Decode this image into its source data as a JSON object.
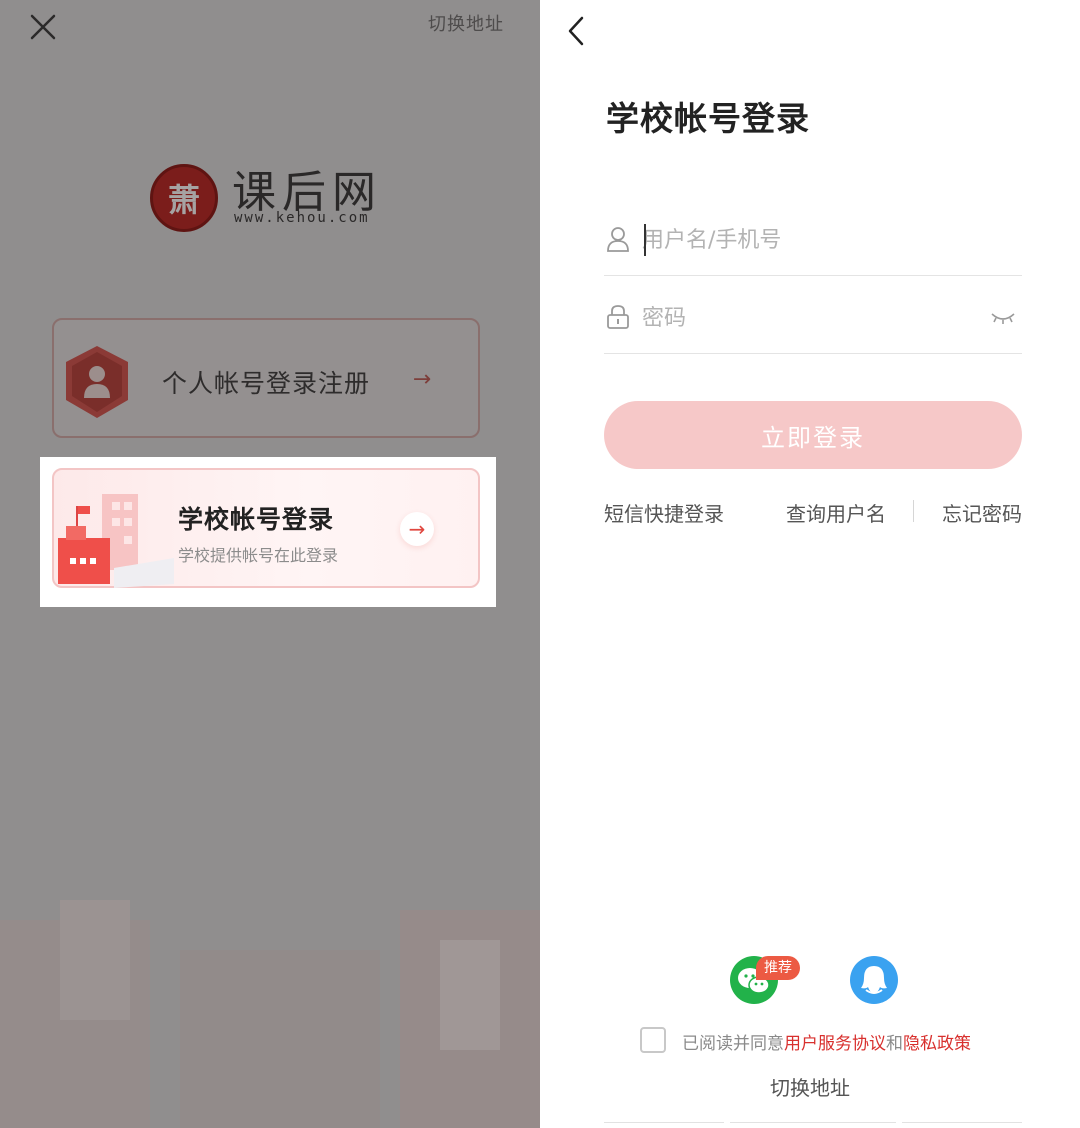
{
  "left": {
    "switch_address": "切换地址",
    "logo": {
      "seal_char": "萧",
      "name": "课后网",
      "url": "www.kehou.com"
    },
    "personal_card": {
      "title": "个人帐号登录注册"
    },
    "school_card": {
      "title": "学校帐号登录",
      "subtitle": "学校提供帐号在此登录"
    },
    "arrow_glyph": "→"
  },
  "right": {
    "title": "学校帐号登录",
    "username_placeholder": "用户名/手机号",
    "password_placeholder": "密码",
    "login_button": "立即登录",
    "links": {
      "sms_login": "短信快捷登录",
      "find_username": "查询用户名",
      "forgot_password": "忘记密码"
    },
    "social": {
      "recommend_tag": "推荐"
    },
    "agreement": {
      "prefix": "已阅读并同意",
      "user_agreement": "用户服务协议",
      "and": "和",
      "privacy_policy": "隐私政策"
    },
    "switch_address": "切换地址"
  },
  "colors": {
    "accent": "#e0473f",
    "button_disabled": "#f6c8c8",
    "link_red": "#d8302e",
    "wechat_green": "#22b24a",
    "qq_blue": "#3aa2f0",
    "overlay_gray": "#908e8e"
  },
  "icons": {
    "close": "close-icon",
    "back": "chevron-left-icon",
    "user": "user-icon",
    "lock": "lock-icon",
    "eye": "eye-closed-icon",
    "wechat": "wechat-icon",
    "qq": "qq-icon"
  }
}
